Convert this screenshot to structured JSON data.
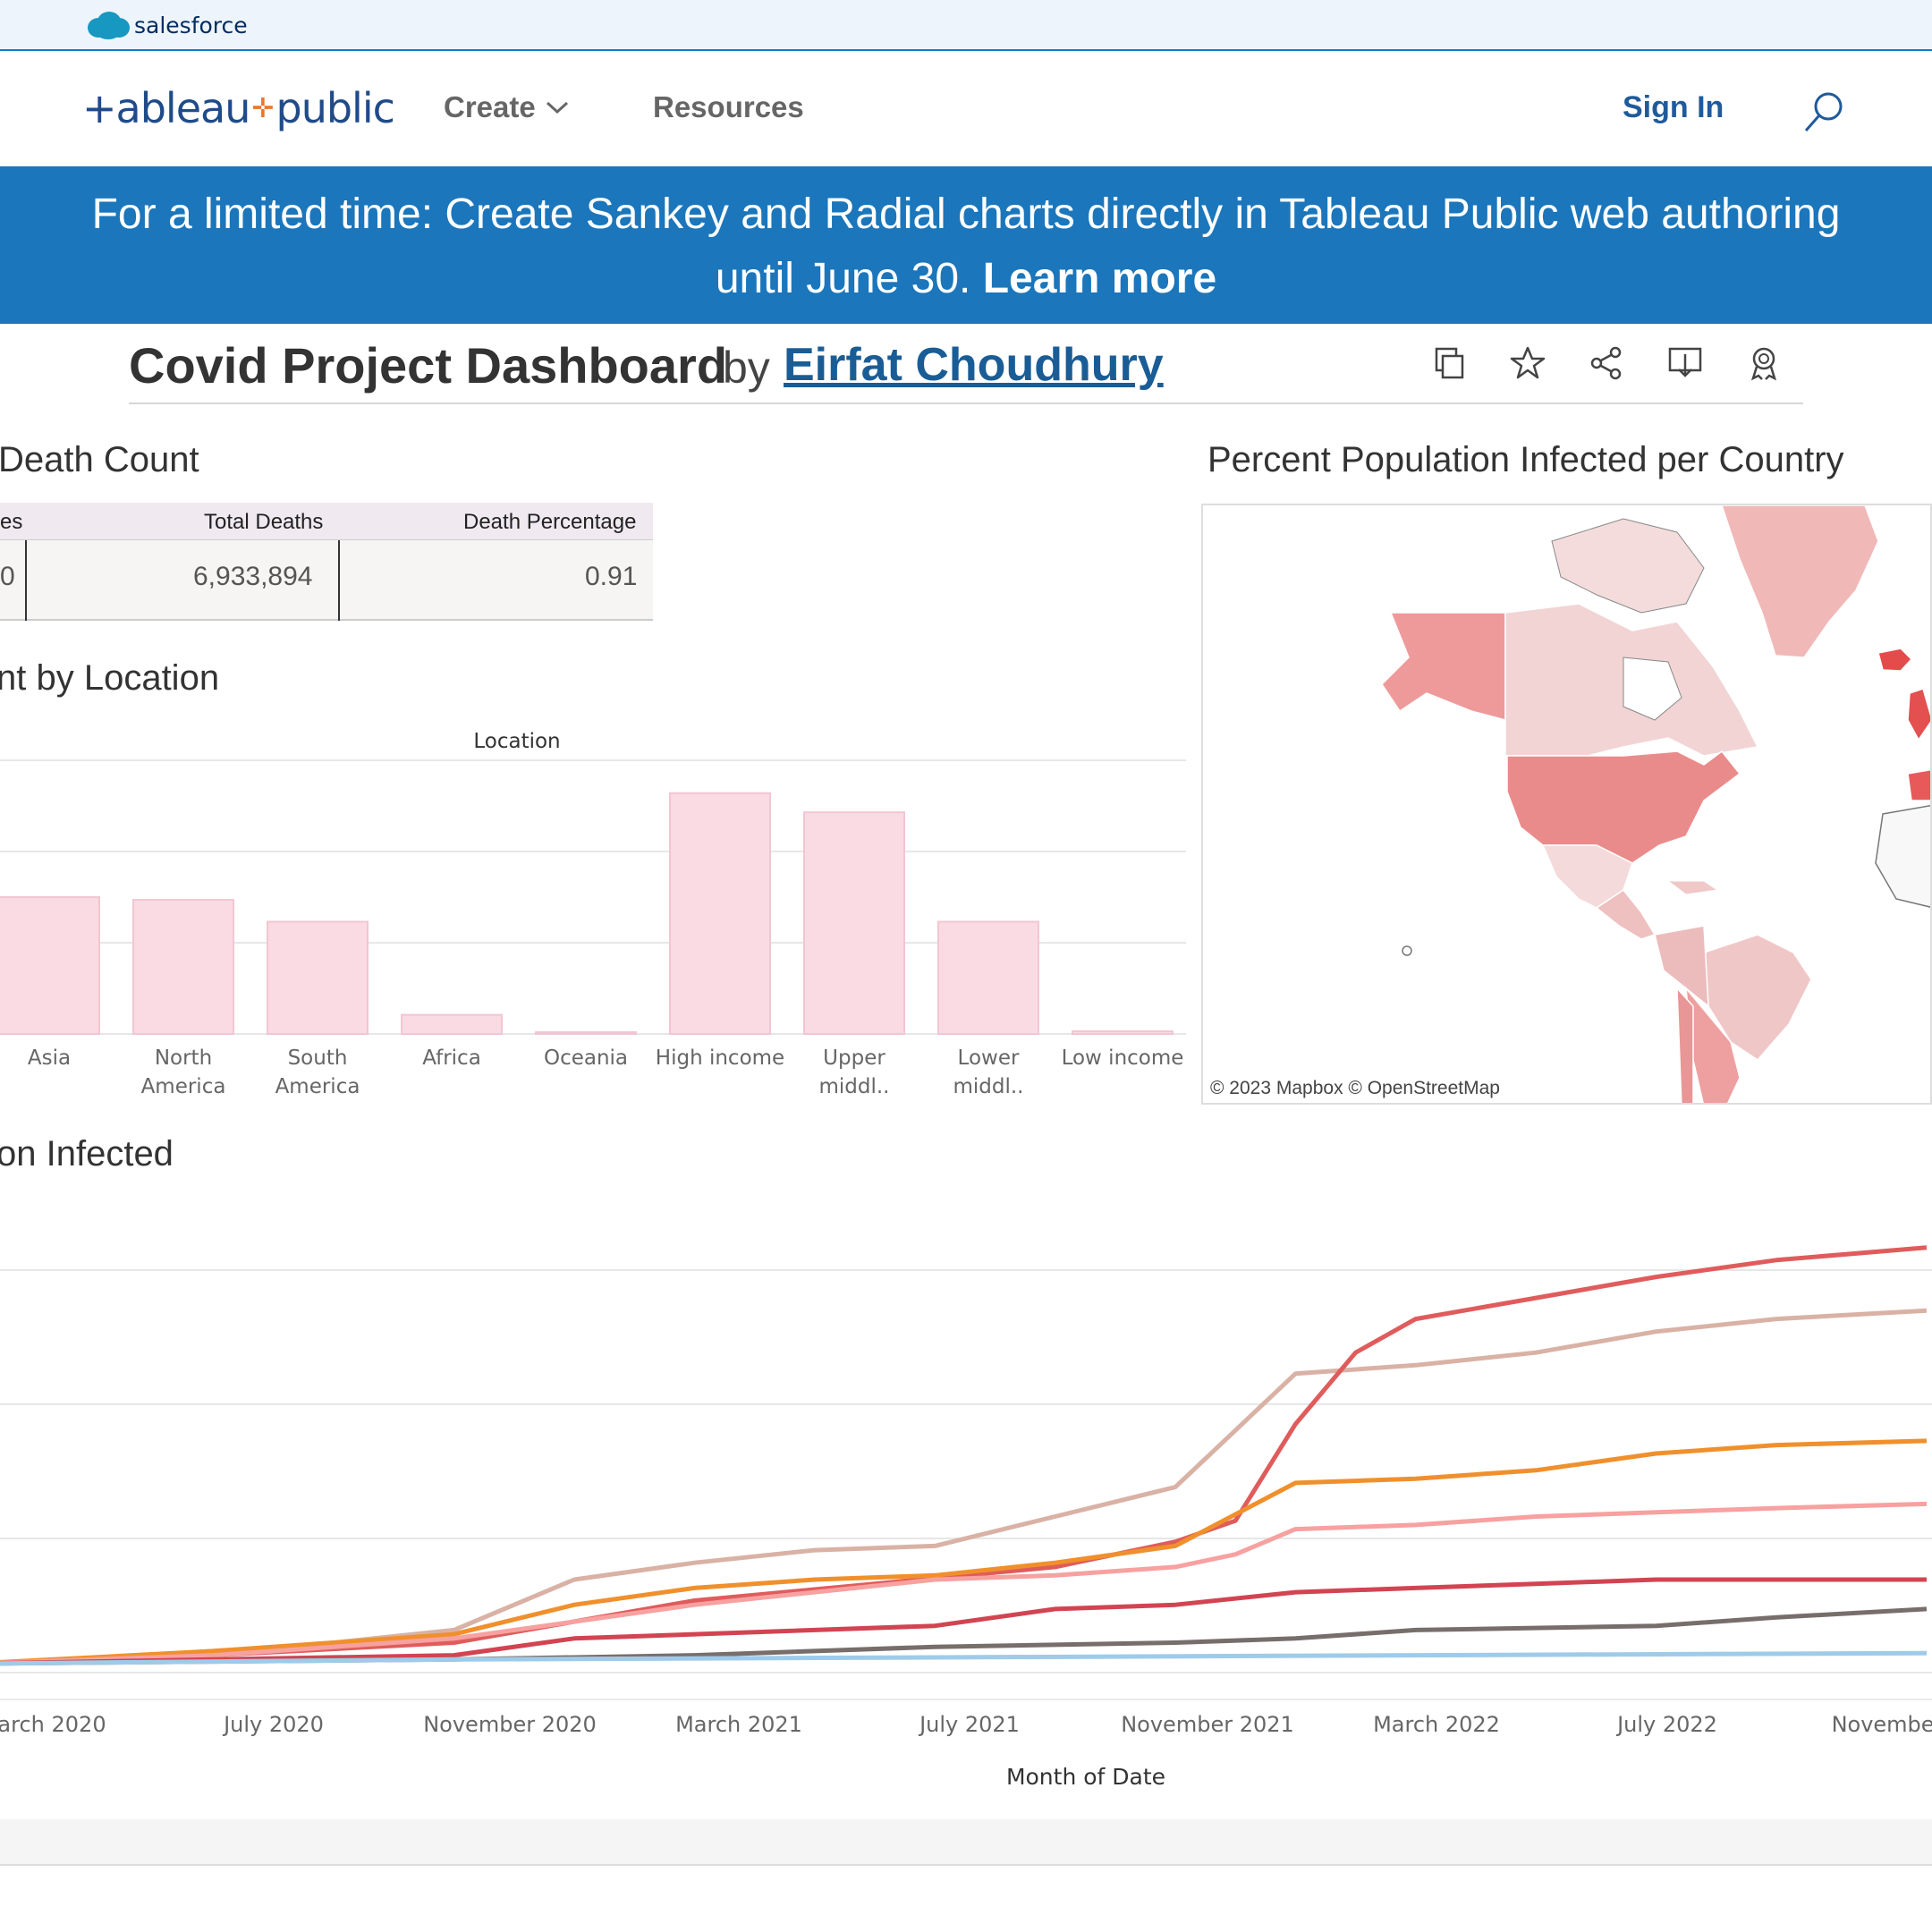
{
  "salesforce": {
    "label": "salesforce"
  },
  "nav": {
    "logo_left": "+ableau",
    "logo_right": "public",
    "create": "Create",
    "resources": "Resources",
    "sign_in": "Sign In"
  },
  "banner": {
    "line1": "For a limited time: Create Sankey and Radial charts directly in Tableau Public web authoring",
    "line2": "until June 30.",
    "link": "Learn more",
    "color": "#1b76bb"
  },
  "viz": {
    "title": "Covid Project Dashboard",
    "by": "by",
    "author": "Eirfat Choudhury",
    "toolbar": [
      "copy-icon",
      "favorite-star-icon",
      "share-icon",
      "download-icon",
      "badge-icon"
    ]
  },
  "death_count": {
    "title": "Death Count",
    "headers": [
      "es",
      "Total Deaths",
      "Death Percentage"
    ],
    "row": [
      "0",
      "6,933,894",
      "0.91"
    ]
  },
  "location_chart": {
    "title": "nt by Location",
    "header": "Location"
  },
  "map": {
    "title": "Percent Population Infected per Country",
    "attribution": "© 2023 Mapbox  © OpenStreetMap"
  },
  "infected_chart": {
    "title": "on Infected"
  },
  "chart_data": [
    {
      "type": "bar",
      "title": "nt by Location",
      "xlabel": "Location",
      "categories": [
        "Asia",
        "North America",
        "South America",
        "Africa",
        "Oceania",
        "High income",
        "Upper middl..",
        "Lower middl..",
        "Low income"
      ],
      "values": [
        0.5,
        0.49,
        0.41,
        0.07,
        0.005,
        0.88,
        0.81,
        0.41,
        0.01
      ],
      "value_scale": "relative (0 = baseline, 1 = top gridline)"
    },
    {
      "type": "line",
      "xlabel": "Month of Date",
      "x": [
        "arch 2020",
        "July 2020",
        "November 2020",
        "March 2021",
        "July 2021",
        "November 2021",
        "March 2022",
        "July 2022",
        "November"
      ],
      "x_numeric": [
        0,
        4,
        8,
        12,
        16,
        20,
        24,
        28,
        32
      ],
      "value_scale": "relative (0 = baseline, 1 = top of plot)",
      "series": [
        {
          "color": "#d9b2a5",
          "points": [
            [
              0,
              0
            ],
            [
              2,
              0.01
            ],
            [
              4,
              0.03
            ],
            [
              6,
              0.05
            ],
            [
              8,
              0.08
            ],
            [
              10,
              0.2
            ],
            [
              12,
              0.24
            ],
            [
              14,
              0.27
            ],
            [
              16,
              0.28
            ],
            [
              18,
              0.35
            ],
            [
              20,
              0.42
            ],
            [
              22,
              0.69
            ],
            [
              24,
              0.71
            ],
            [
              26,
              0.74
            ],
            [
              28,
              0.79
            ],
            [
              30,
              0.82
            ],
            [
              32.5,
              0.84
            ]
          ]
        },
        {
          "color": "#e05c5c",
          "points": [
            [
              0,
              0
            ],
            [
              4,
              0.02
            ],
            [
              8,
              0.05
            ],
            [
              12,
              0.15
            ],
            [
              15,
              0.19
            ],
            [
              18,
              0.23
            ],
            [
              20,
              0.29
            ],
            [
              21,
              0.34
            ],
            [
              22,
              0.57
            ],
            [
              23,
              0.74
            ],
            [
              24,
              0.82
            ],
            [
              26,
              0.87
            ],
            [
              28,
              0.92
            ],
            [
              30,
              0.96
            ],
            [
              32.5,
              0.99
            ]
          ]
        },
        {
          "color": "#f0902c",
          "points": [
            [
              0,
              0
            ],
            [
              4,
              0.03
            ],
            [
              8,
              0.07
            ],
            [
              10,
              0.14
            ],
            [
              12,
              0.18
            ],
            [
              14,
              0.2
            ],
            [
              16,
              0.21
            ],
            [
              18,
              0.24
            ],
            [
              20,
              0.28
            ],
            [
              22,
              0.43
            ],
            [
              24,
              0.44
            ],
            [
              26,
              0.46
            ],
            [
              28,
              0.5
            ],
            [
              30,
              0.52
            ],
            [
              32.5,
              0.53
            ]
          ]
        },
        {
          "color": "#f7a1a0",
          "points": [
            [
              0,
              0
            ],
            [
              4,
              0.02
            ],
            [
              8,
              0.06
            ],
            [
              12,
              0.14
            ],
            [
              16,
              0.2
            ],
            [
              18,
              0.21
            ],
            [
              20,
              0.23
            ],
            [
              21,
              0.26
            ],
            [
              22,
              0.32
            ],
            [
              24,
              0.33
            ],
            [
              26,
              0.35
            ],
            [
              28,
              0.36
            ],
            [
              30,
              0.37
            ],
            [
              32.5,
              0.38
            ]
          ]
        },
        {
          "color": "#d24452",
          "points": [
            [
              0,
              0
            ],
            [
              4,
              0.01
            ],
            [
              8,
              0.02
            ],
            [
              10,
              0.06
            ],
            [
              12,
              0.07
            ],
            [
              16,
              0.09
            ],
            [
              18,
              0.13
            ],
            [
              20,
              0.14
            ],
            [
              22,
              0.17
            ],
            [
              24,
              0.18
            ],
            [
              26,
              0.19
            ],
            [
              28,
              0.2
            ],
            [
              32.5,
              0.2
            ]
          ]
        },
        {
          "color": "#776e6b",
          "points": [
            [
              0,
              0
            ],
            [
              4,
              0.005
            ],
            [
              8,
              0.01
            ],
            [
              12,
              0.02
            ],
            [
              16,
              0.04
            ],
            [
              20,
              0.05
            ],
            [
              22,
              0.06
            ],
            [
              24,
              0.08
            ],
            [
              28,
              0.09
            ],
            [
              30,
              0.11
            ],
            [
              32.5,
              0.13
            ]
          ]
        },
        {
          "color": "#9fcbea",
          "points": [
            [
              0,
              0
            ],
            [
              8,
              0.01
            ],
            [
              16,
              0.015
            ],
            [
              24,
              0.02
            ],
            [
              32.5,
              0.025
            ]
          ]
        }
      ]
    }
  ],
  "colors": {
    "accent": "#1b76bb",
    "bar_fill": "#fadbe4",
    "map_high": "#e96666",
    "map_low": "#f3d4d4"
  }
}
